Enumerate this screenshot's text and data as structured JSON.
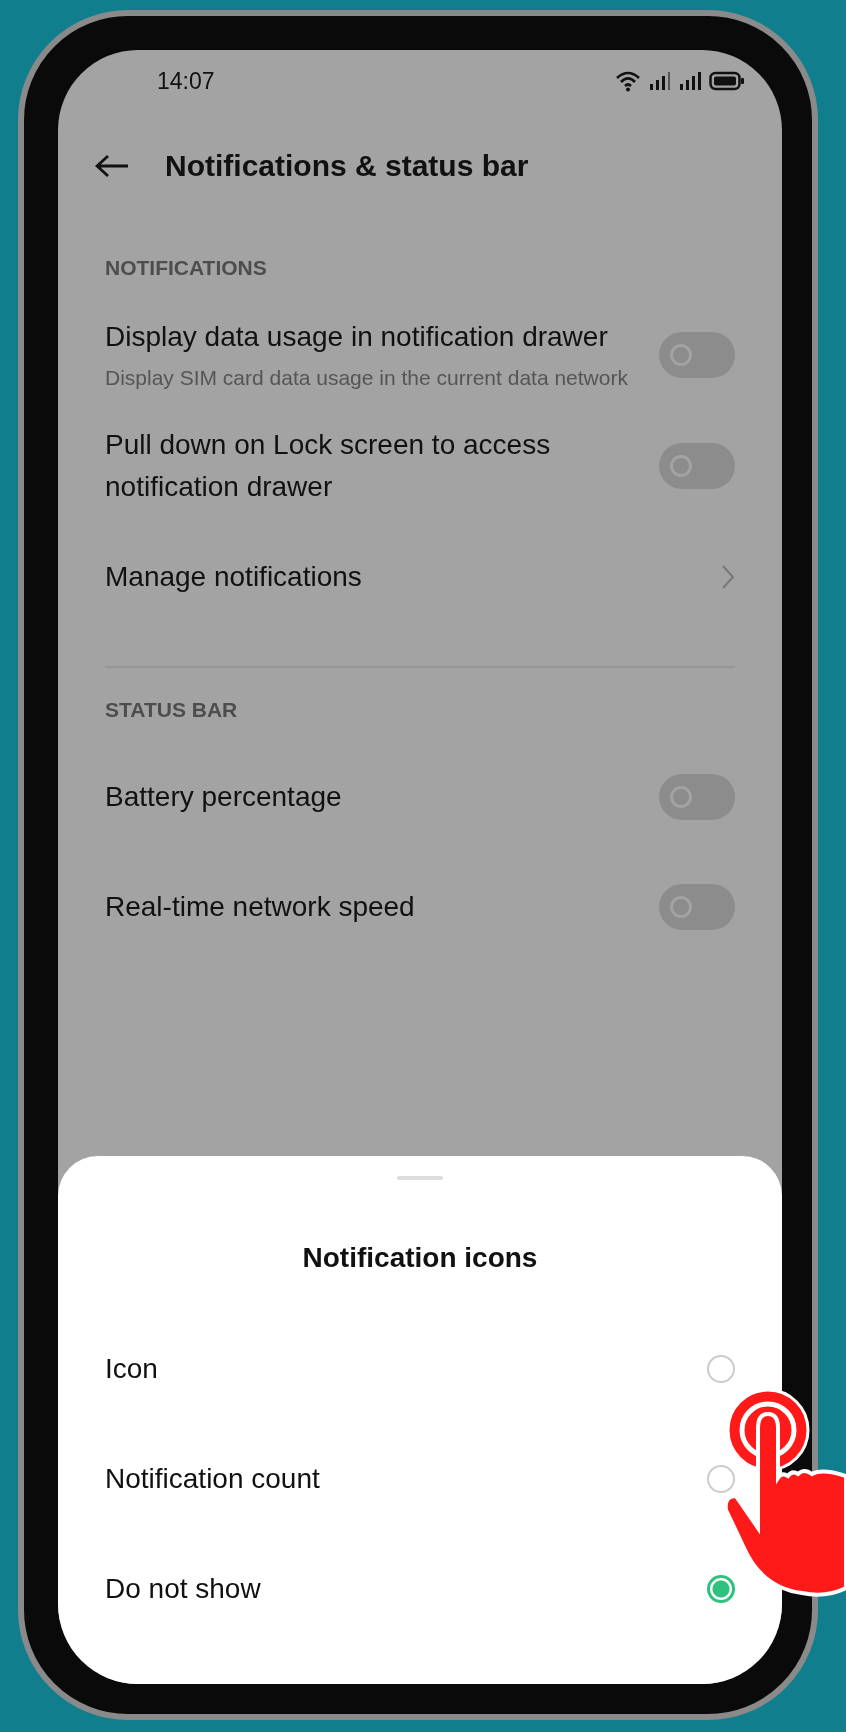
{
  "status_bar": {
    "time": "14:07"
  },
  "header": {
    "title": "Notifications & status bar"
  },
  "sections": [
    {
      "heading": "NOTIFICATIONS",
      "items": [
        {
          "kind": "toggle",
          "title": "Display data usage in notification drawer",
          "subtitle": "Display SIM card data usage in the current data network",
          "on": false
        },
        {
          "kind": "toggle",
          "title": "Pull down on Lock screen to access notification drawer",
          "on": false
        },
        {
          "kind": "link",
          "title": "Manage notifications"
        }
      ]
    },
    {
      "heading": "STATUS BAR",
      "items": [
        {
          "kind": "toggle",
          "title": "Battery percentage",
          "on": false
        },
        {
          "kind": "toggle",
          "title": "Real-time network speed",
          "on": false
        }
      ]
    }
  ],
  "sheet": {
    "title": "Notification icons",
    "options": [
      {
        "label": "Icon",
        "selected": false
      },
      {
        "label": "Notification count",
        "selected": false
      },
      {
        "label": "Do not show",
        "selected": true
      }
    ]
  }
}
